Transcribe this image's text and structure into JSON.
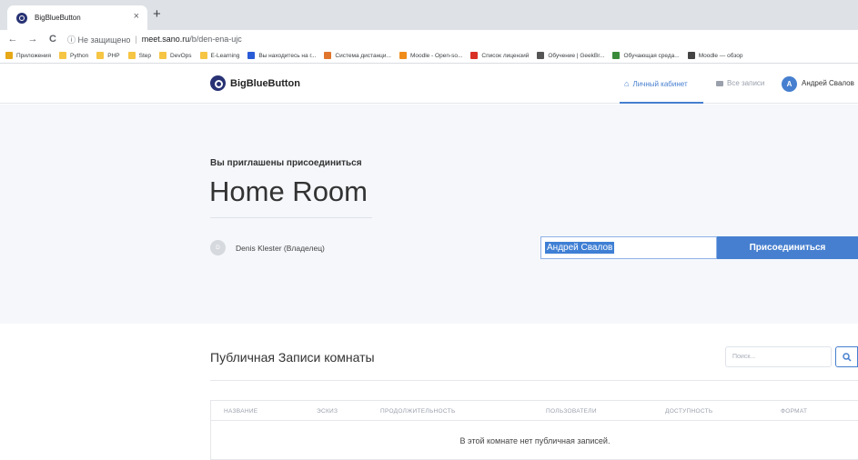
{
  "browser": {
    "tab_title": "BigBlueButton",
    "tab_close": "×",
    "new_tab": "+",
    "back": "←",
    "forward": "→",
    "reload": "C",
    "security_label": "ⓘ Не защищено",
    "domain": "meet.sano.ru",
    "path": "/b/den-ena-ujc",
    "bookmarks": [
      {
        "label": "Приложения",
        "color": "#e6a817"
      },
      {
        "label": "Python",
        "color": "#f6c544"
      },
      {
        "label": "PHP",
        "color": "#f6c544"
      },
      {
        "label": "Step",
        "color": "#f6c544"
      },
      {
        "label": "DevOps",
        "color": "#f6c544"
      },
      {
        "label": "E-Learning",
        "color": "#f6c544"
      },
      {
        "label": "Вы находитесь на г...",
        "color": "#2a5bd7"
      },
      {
        "label": "Система дистанци...",
        "color": "#e0752d"
      },
      {
        "label": "Moodle - Open-so...",
        "color": "#f08c1a"
      },
      {
        "label": "Список лицензий",
        "color": "#d93025"
      },
      {
        "label": "Обучение | GeekBr...",
        "color": "#555555"
      },
      {
        "label": "Обучающая среда...",
        "color": "#3a8a3a"
      },
      {
        "label": "Moodle — обзор",
        "color": "#444444"
      }
    ]
  },
  "header": {
    "logo_text": "BigBlueButton",
    "nav_home": "Личный кабинет",
    "nav_recordings": "Все записи",
    "avatar_letter": "A",
    "user_name": "Андрей Свалов"
  },
  "hero": {
    "invite_text": "Вы приглашены присоединиться",
    "room_title": "Home Room",
    "owner_initial": "D",
    "owner_name": "Denis Klester (Владелец)",
    "join_value": "Андрей Свалов",
    "join_button": "Присоединиться"
  },
  "recordings": {
    "title": "Публичная Записи комнаты",
    "search_placeholder": "Поиск...",
    "columns": [
      "НАЗВАНИЕ",
      "ЭСКИЗ",
      "ПРОДОЛЖИТЕЛЬНОСТЬ",
      "ПОЛЬЗОВАТЕЛИ",
      "ДОСТУПНОСТЬ",
      "ФОРМАТ"
    ],
    "empty_message": "В этой комнате нет публичная записей."
  },
  "colors": {
    "accent": "#467fcf",
    "logo": "#283274",
    "hero_bg": "#f5f7fb"
  }
}
